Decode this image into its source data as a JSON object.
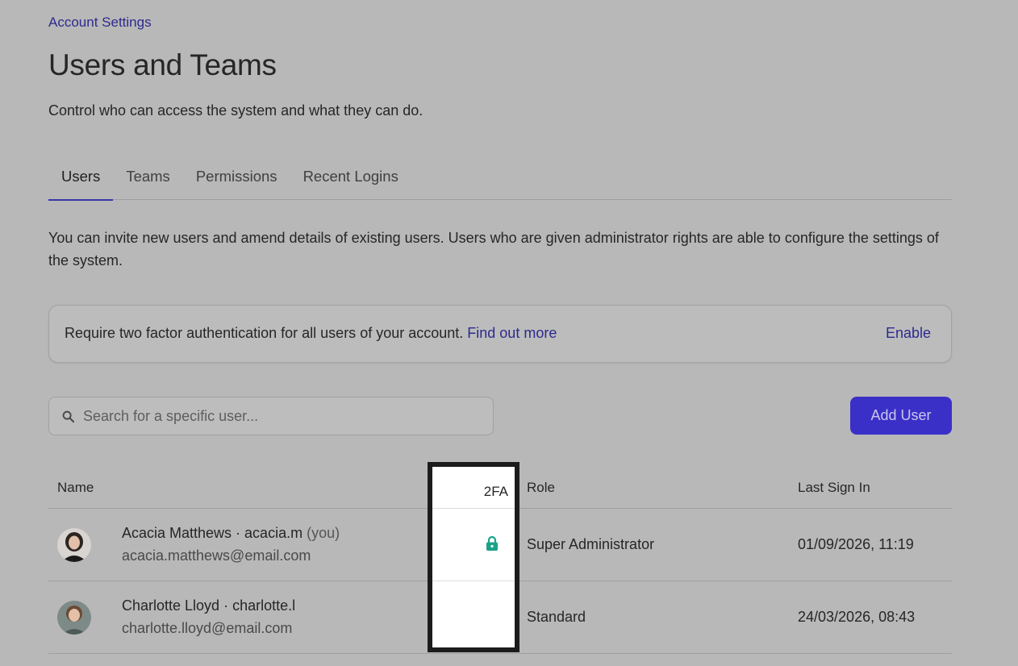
{
  "breadcrumb": "Account Settings",
  "page": {
    "title": "Users and Teams",
    "subtitle": "Control who can access the system and what they can do."
  },
  "tabs": [
    {
      "label": "Users",
      "active": true
    },
    {
      "label": "Teams",
      "active": false
    },
    {
      "label": "Permissions",
      "active": false
    },
    {
      "label": "Recent Logins",
      "active": false
    }
  ],
  "intro": "You can invite new users and amend details of existing users. Users who are given administrator rights are able to configure the settings of the system.",
  "banner": {
    "text": "Require two factor authentication for all users of your account.",
    "link": "Find out more",
    "action": "Enable"
  },
  "search": {
    "placeholder": "Search for a specific user...",
    "icon": "search-icon"
  },
  "add_user": "Add User",
  "table": {
    "headers": {
      "name": "Name",
      "twofa": "2FA",
      "role": "Role",
      "last_sign_in": "Last Sign In"
    },
    "rows": [
      {
        "name": "Acacia Matthews · acacia.m",
        "you": "(you)",
        "email": "acacia.matthews@email.com",
        "twofa_icon": "lock-icon",
        "role": "Super Administrator",
        "last_sign_in": "01/09/2026, 11:19"
      },
      {
        "name": "Charlotte Lloyd · charlotte.l",
        "you": "",
        "email": "charlotte.lloyd@email.com",
        "twofa_icon": "",
        "role": "Standard",
        "last_sign_in": "24/03/2026, 08:43"
      }
    ]
  },
  "colors": {
    "accent": "#3a30c8",
    "link": "#2d2a8f",
    "lock": "#1aa38a",
    "background": "#b8b8b8"
  }
}
